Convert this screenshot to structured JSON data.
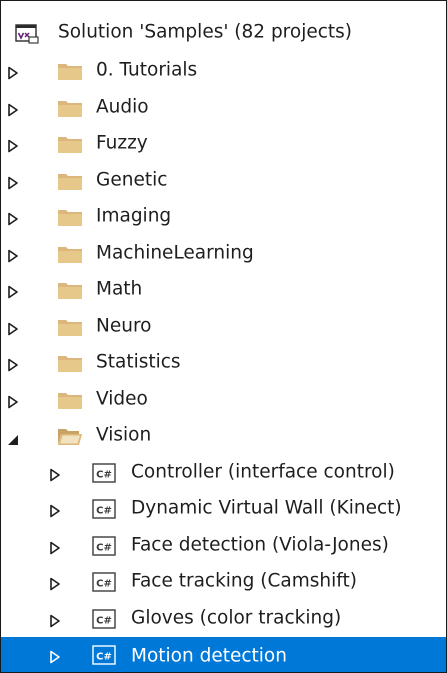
{
  "solution": {
    "label": "Solution 'Samples' (82 projects)",
    "icon": "solution-icon"
  },
  "folders": [
    {
      "label": "0. Tutorials",
      "expanded": false
    },
    {
      "label": "Audio",
      "expanded": false
    },
    {
      "label": "Fuzzy",
      "expanded": false
    },
    {
      "label": "Genetic",
      "expanded": false
    },
    {
      "label": "Imaging",
      "expanded": false
    },
    {
      "label": "MachineLearning",
      "expanded": false
    },
    {
      "label": "Math",
      "expanded": false
    },
    {
      "label": "Neuro",
      "expanded": false
    },
    {
      "label": "Statistics",
      "expanded": false
    },
    {
      "label": "Video",
      "expanded": false
    },
    {
      "label": "Vision",
      "expanded": true
    }
  ],
  "vision_projects": [
    {
      "label": "Controller (interface control)",
      "icon": "csharp-project-icon",
      "selected": false
    },
    {
      "label": "Dynamic Virtual Wall (Kinect)",
      "icon": "csharp-project-icon",
      "selected": false
    },
    {
      "label": "Face detection (Viola-Jones)",
      "icon": "csharp-project-icon",
      "selected": false
    },
    {
      "label": "Face tracking (Camshift)",
      "icon": "csharp-project-icon",
      "selected": false
    },
    {
      "label": "Gloves (color tracking)",
      "icon": "csharp-project-icon",
      "selected": false
    },
    {
      "label": "Motion detection",
      "icon": "csharp-project-icon",
      "selected": true
    }
  ],
  "project_icon_text": "C#",
  "colors": {
    "selection": "#0078d7",
    "folder": "#dcb67a",
    "text": "#1e1e1e"
  }
}
